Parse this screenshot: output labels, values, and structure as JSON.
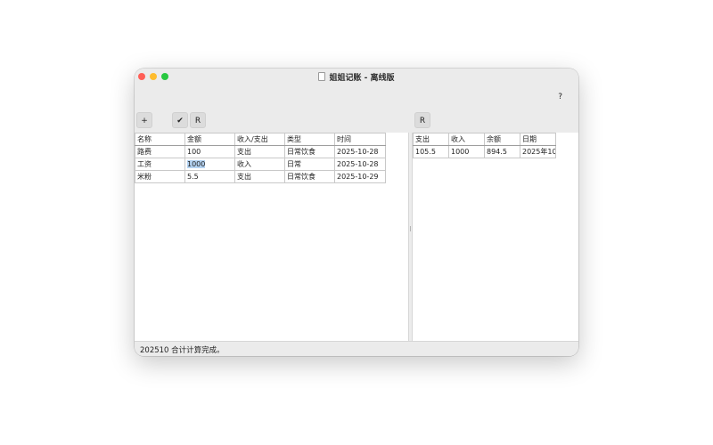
{
  "window": {
    "title": "姐姐记账 - 离线版"
  },
  "toolbar": {
    "help_label": "?",
    "add_label": "+",
    "confirm_label": "✔",
    "refresh_left_label": "R",
    "refresh_right_label": "R"
  },
  "records_table": {
    "headers": [
      "名称",
      "金额",
      "收入/支出",
      "类型",
      "时间"
    ],
    "rows": [
      [
        "路费",
        "100",
        "支出",
        "日常饮食",
        "2025-10-28"
      ],
      [
        "工资",
        "1000",
        "收入",
        "日常",
        "2025-10-28"
      ],
      [
        "米粉",
        "5.5",
        "支出",
        "日常饮食",
        "2025-10-29"
      ]
    ]
  },
  "summary_table": {
    "headers": [
      "支出",
      "收入",
      "余额",
      "日期"
    ],
    "rows": [
      [
        "105.5",
        "1000",
        "894.5",
        "2025年10"
      ]
    ]
  },
  "status": {
    "text": "202510 合计计算完成。"
  },
  "colors": {
    "close": "#ff5f57",
    "minimize": "#febc2e",
    "maximize": "#28c840",
    "selection": "#b4d3f2"
  }
}
